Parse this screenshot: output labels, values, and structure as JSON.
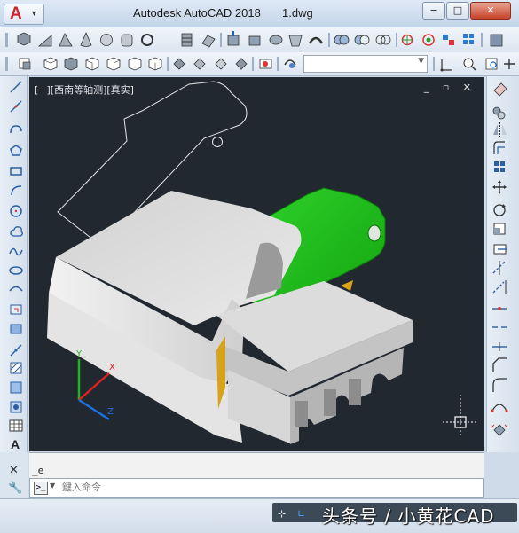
{
  "app": {
    "logo_letter": "A",
    "title": "Autodesk AutoCAD 2018",
    "file_name": "1.dwg",
    "accent_color": "#c8262c"
  },
  "window_controls": {
    "minimize": "−",
    "maximize": "□",
    "close": "✕"
  },
  "toolbar1": {
    "icons": [
      "box-icon",
      "wedge-icon",
      "pyramid-icon",
      "cone-icon",
      "sphere-icon",
      "cylinder-icon",
      "torus-icon",
      "polysolid-icon",
      "planar-surface-icon",
      "extrude-icon",
      "presspull-icon",
      "revolve-icon",
      "loft-icon",
      "sweep-icon",
      "union-icon",
      "subtract-icon",
      "intersect-icon",
      "3d-move-icon",
      "3d-rotate-icon",
      "3d-align-icon",
      "3d-array-icon"
    ]
  },
  "toolbar2": {
    "icons": [
      "ucs-icon",
      "top-view-icon",
      "bottom-view-icon",
      "left-view-icon",
      "right-view-icon",
      "front-view-icon",
      "back-view-icon",
      "sw-iso-icon",
      "se-iso-icon",
      "ne-iso-icon",
      "nw-iso-icon",
      "camera-icon",
      "orbit-icon"
    ],
    "layer_select_value": ""
  },
  "left_sidebar_icons": [
    "line-icon",
    "construction-line-icon",
    "polyline-icon",
    "polygon-icon",
    "rectangle-icon",
    "arc-icon",
    "circle-icon",
    "revision-cloud-icon",
    "spline-icon",
    "ellipse-icon",
    "ellipse-arc-icon",
    "insert-block-icon",
    "make-block-icon",
    "point-icon",
    "hatch-icon",
    "gradient-icon",
    "region-icon",
    "table-icon",
    "multiline-text-icon"
  ],
  "right_sidebar_icons": [
    "erase-icon",
    "copy-icon",
    "mirror-icon",
    "offset-icon",
    "array-icon",
    "move-icon",
    "rotate-icon",
    "scale-icon",
    "stretch-icon",
    "trim-icon",
    "extend-icon",
    "break-at-point-icon",
    "break-icon",
    "join-icon",
    "chamfer-icon",
    "fillet-icon",
    "blend-curves-icon",
    "explode-icon"
  ],
  "viewport": {
    "label": "[−][西南等轴测][真实]",
    "controls": "_ ▫ ✕",
    "background": "#212830",
    "model_green": "#22c41f",
    "model_grey": "#d8d8d8",
    "model_gold": "#d8a21b"
  },
  "command": {
    "history": "_e",
    "placeholder": "鍵入命令"
  },
  "status": {
    "watermark": "头条号 / 小黄花CAD"
  }
}
